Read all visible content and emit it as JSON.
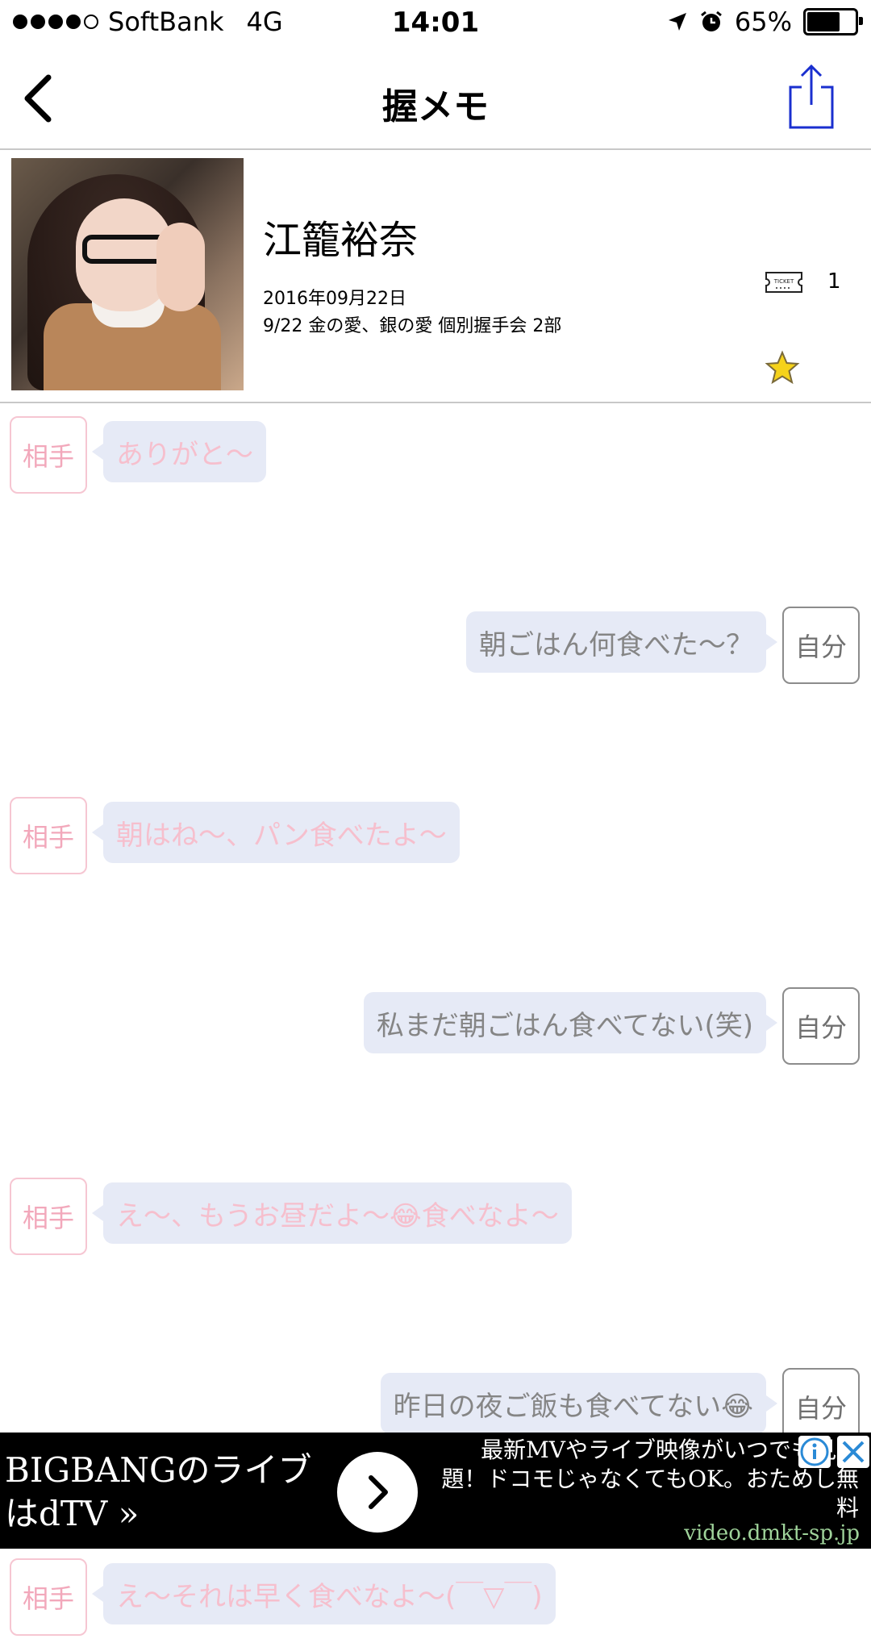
{
  "status_bar": {
    "carrier": "SoftBank",
    "network": "4G",
    "time": "14:01",
    "battery_percent_label": "65%",
    "battery_level": 0.65,
    "icons": [
      "signal-dots-icon",
      "location-arrow-icon",
      "alarm-clock-icon",
      "battery-icon"
    ]
  },
  "nav": {
    "title": "握メモ",
    "back_icon": "chevron-left-icon",
    "share_icon": "share-icon"
  },
  "profile": {
    "name": "江籠裕奈",
    "date": "2016年09月22日",
    "event": "9/22 金の愛、銀の愛 個別握手会 2部",
    "ticket_count": "1",
    "ticket_icon": "ticket-icon",
    "star_icon": "star-icon"
  },
  "labels": {
    "partner": "相手",
    "self": "自分"
  },
  "messages": [
    {
      "side": "partner",
      "text": "ありがと〜"
    },
    {
      "side": "self",
      "text": "朝ごはん何食べた〜？"
    },
    {
      "side": "partner",
      "text": "朝はね〜、パン食べたよ〜"
    },
    {
      "side": "self",
      "text": "私まだ朝ごはん食べてない(笑)"
    },
    {
      "side": "partner",
      "text": "え〜、もうお昼だよ〜😂食べなよ〜"
    },
    {
      "side": "self",
      "text": "昨日の夜ご飯も食べてない😂"
    },
    {
      "side": "partner",
      "text": "え〜それは早く食べなよ〜(￣▽￣)"
    }
  ],
  "ad": {
    "left_text": "BIGBANGのライブはdTV »",
    "right_text": "最新MVやライブ映像がいつでも見放題！ドコモじゃなくてもOK。おためし無料",
    "domain": "video.dmkt-sp.jp",
    "colors": {
      "background": "#000000",
      "domain": "#9fd39a"
    }
  },
  "colors": {
    "partner_text": "#f6bfcd",
    "partner_border": "#f6c6d2",
    "self_text": "#858585",
    "bubble_bg": "#e6eaf6",
    "share_icon": "#1a2fcf",
    "star": "#f5d21a"
  }
}
